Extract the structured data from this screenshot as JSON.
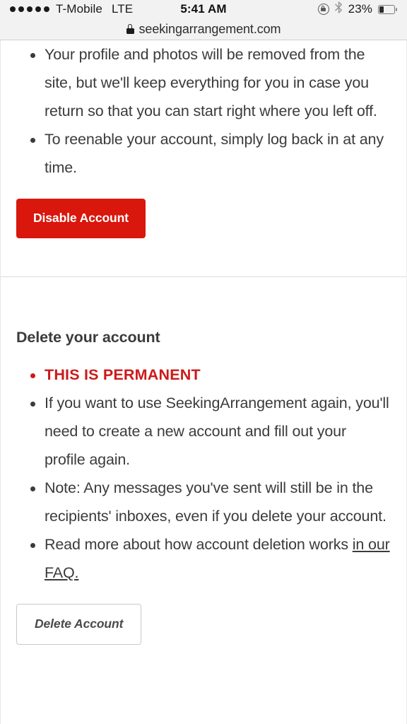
{
  "status_bar": {
    "signal_dots": 5,
    "carrier": "T-Mobile",
    "network_type": "LTE",
    "time": "5:41 AM",
    "battery_percent": "23%",
    "icons": [
      "rotation-lock-icon",
      "bluetooth-icon",
      "battery-icon"
    ]
  },
  "browser": {
    "secure_icon": "lock-icon",
    "url": "seekingarrangement.com"
  },
  "disable_section": {
    "bullets": [
      "Your profile and photos will be removed from the site, but we'll keep everything for you in case you return so that you can start right where you left off.",
      "To reenable your account, simply log back in at any time."
    ],
    "button_label": "Disable Account"
  },
  "delete_section": {
    "title": "Delete your account",
    "warning": "THIS IS PERMANENT",
    "bullets": [
      "If you want to use SeekingArrangement again, you'll need to create a new account and fill out your profile again.",
      "Note: Any messages you've sent will still be in the recipients' inboxes, even if you delete your account."
    ],
    "faq_bullet_prefix": "Read more about how account deletion works ",
    "faq_link_text": "in our FAQ.",
    "button_label": "Delete Account"
  },
  "colors": {
    "danger_red": "#d9170c",
    "warning_red": "#cc1a1a",
    "body_text": "#3b3b3b",
    "status_bar_bg": "#f2f2f2"
  }
}
